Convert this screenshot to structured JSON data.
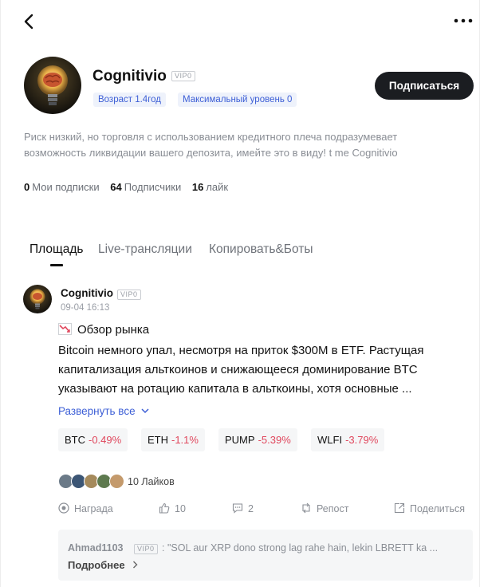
{
  "profile": {
    "name": "Cognitivio",
    "vip_badge": "VIP0",
    "chips": [
      "Возраст 1.4год",
      "Максимальный уровень 0"
    ],
    "subscribe_label": "Подписаться",
    "description": "Риск низкий, но торговля с использованием кредитного плеча подразумевает возможность ликвидации вашего депозита, имейте это в виду! t me Cognitivio",
    "stats": [
      {
        "count": "0",
        "label": "Мои подписки"
      },
      {
        "count": "64",
        "label": "Подписчики"
      },
      {
        "count": "16",
        "label": "лайк"
      }
    ]
  },
  "tabs": [
    "Площадь",
    "Live-трансляции",
    "Копировать&Боты"
  ],
  "post": {
    "author": "Cognitivio",
    "vip_badge": "VIP0",
    "time": "09-04 16:13",
    "title": "Обзор рынка",
    "body": "Bitcoin немного упал, несмотря на приток $300M в ETF. Растущая капитализация альткоинов и снижающееся доминирование BTC указывают на ротацию капитала в альткоины, хотя основные ...",
    "expand_label": "Развернуть все",
    "tickers": [
      {
        "symbol": "BTC",
        "change": "-0.49%"
      },
      {
        "symbol": "ETH",
        "change": "-1.1%"
      },
      {
        "symbol": "PUMP",
        "change": "-5.39%"
      },
      {
        "symbol": "WLFI",
        "change": "-3.79%"
      }
    ],
    "likes_label": "10 Лайков",
    "actions": {
      "reward": "Награда",
      "like": "10",
      "comment": "2",
      "repost": "Репост",
      "share": "Поделиться"
    },
    "top_comment": {
      "user": "Ahmad1103",
      "vip_badge": "VIP0",
      "text": ": \"SOL aur XRP dono strong lag rahe hain, lekin LBRETT ka ...",
      "more_label": "Подробнее"
    }
  },
  "colors": {
    "accent": "#3d5fd6",
    "negative": "#e0475d",
    "button_dark": "#1b1d21"
  }
}
